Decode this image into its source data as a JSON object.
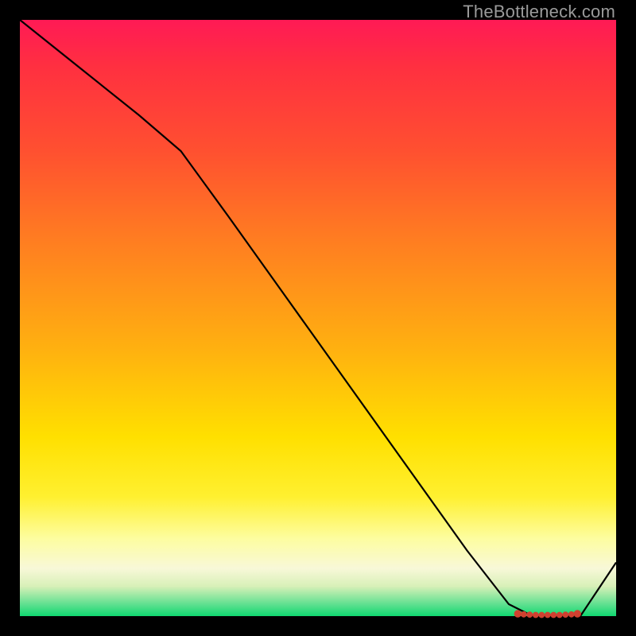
{
  "watermark": "TheBottleneck.com",
  "chart_data": {
    "type": "line",
    "title": "",
    "xlabel": "",
    "ylabel": "",
    "xlim": [
      0,
      100
    ],
    "ylim": [
      0,
      100
    ],
    "grid": false,
    "series": [
      {
        "name": "curve",
        "x": [
          0,
          10,
          20,
          27,
          35,
          45,
          55,
          65,
          75,
          82,
          86,
          88,
          90,
          92,
          94,
          100
        ],
        "values": [
          100,
          92,
          84,
          78,
          67,
          53,
          39,
          25,
          11,
          2,
          0,
          0,
          0,
          0,
          0,
          9
        ]
      }
    ],
    "markers": {
      "name": "optimal-points",
      "x": [
        83.5,
        84.5,
        85.5,
        86.5,
        87.5,
        88.5,
        89.5,
        90.5,
        91.5,
        92.5,
        93.5
      ],
      "values": [
        0.4,
        0.3,
        0.25,
        0.2,
        0.2,
        0.2,
        0.2,
        0.2,
        0.25,
        0.3,
        0.4
      ]
    },
    "gradient_stops": [
      {
        "pos": 0.0,
        "color": "#ff1a55"
      },
      {
        "pos": 0.08,
        "color": "#ff3040"
      },
      {
        "pos": 0.22,
        "color": "#ff5030"
      },
      {
        "pos": 0.38,
        "color": "#ff8020"
      },
      {
        "pos": 0.55,
        "color": "#ffb010"
      },
      {
        "pos": 0.7,
        "color": "#ffe000"
      },
      {
        "pos": 0.8,
        "color": "#fff030"
      },
      {
        "pos": 0.87,
        "color": "#fdfda0"
      },
      {
        "pos": 0.92,
        "color": "#f8f8d8"
      },
      {
        "pos": 0.95,
        "color": "#d8f0b8"
      },
      {
        "pos": 0.98,
        "color": "#60e090"
      },
      {
        "pos": 1.0,
        "color": "#10d870"
      }
    ]
  }
}
